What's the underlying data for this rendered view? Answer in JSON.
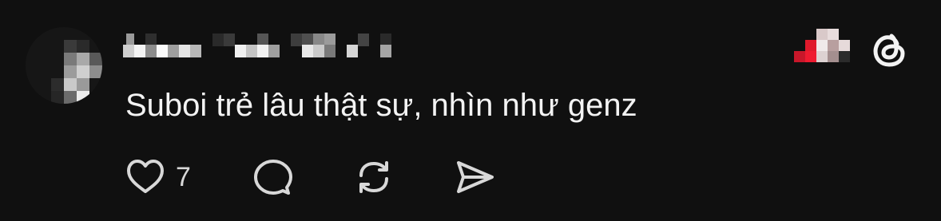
{
  "post": {
    "text": "Suboi trẻ lâu thật sự, nhìn như genz",
    "like_count": "7"
  },
  "icons": {
    "logo": "threads-logo-icon",
    "like": "heart-icon",
    "reply": "comment-bubble-icon",
    "repost": "repost-icon",
    "share": "send-icon"
  },
  "colors": {
    "background": "#101010",
    "text": "#f3f3f3",
    "icon": "#d8d8d8"
  }
}
